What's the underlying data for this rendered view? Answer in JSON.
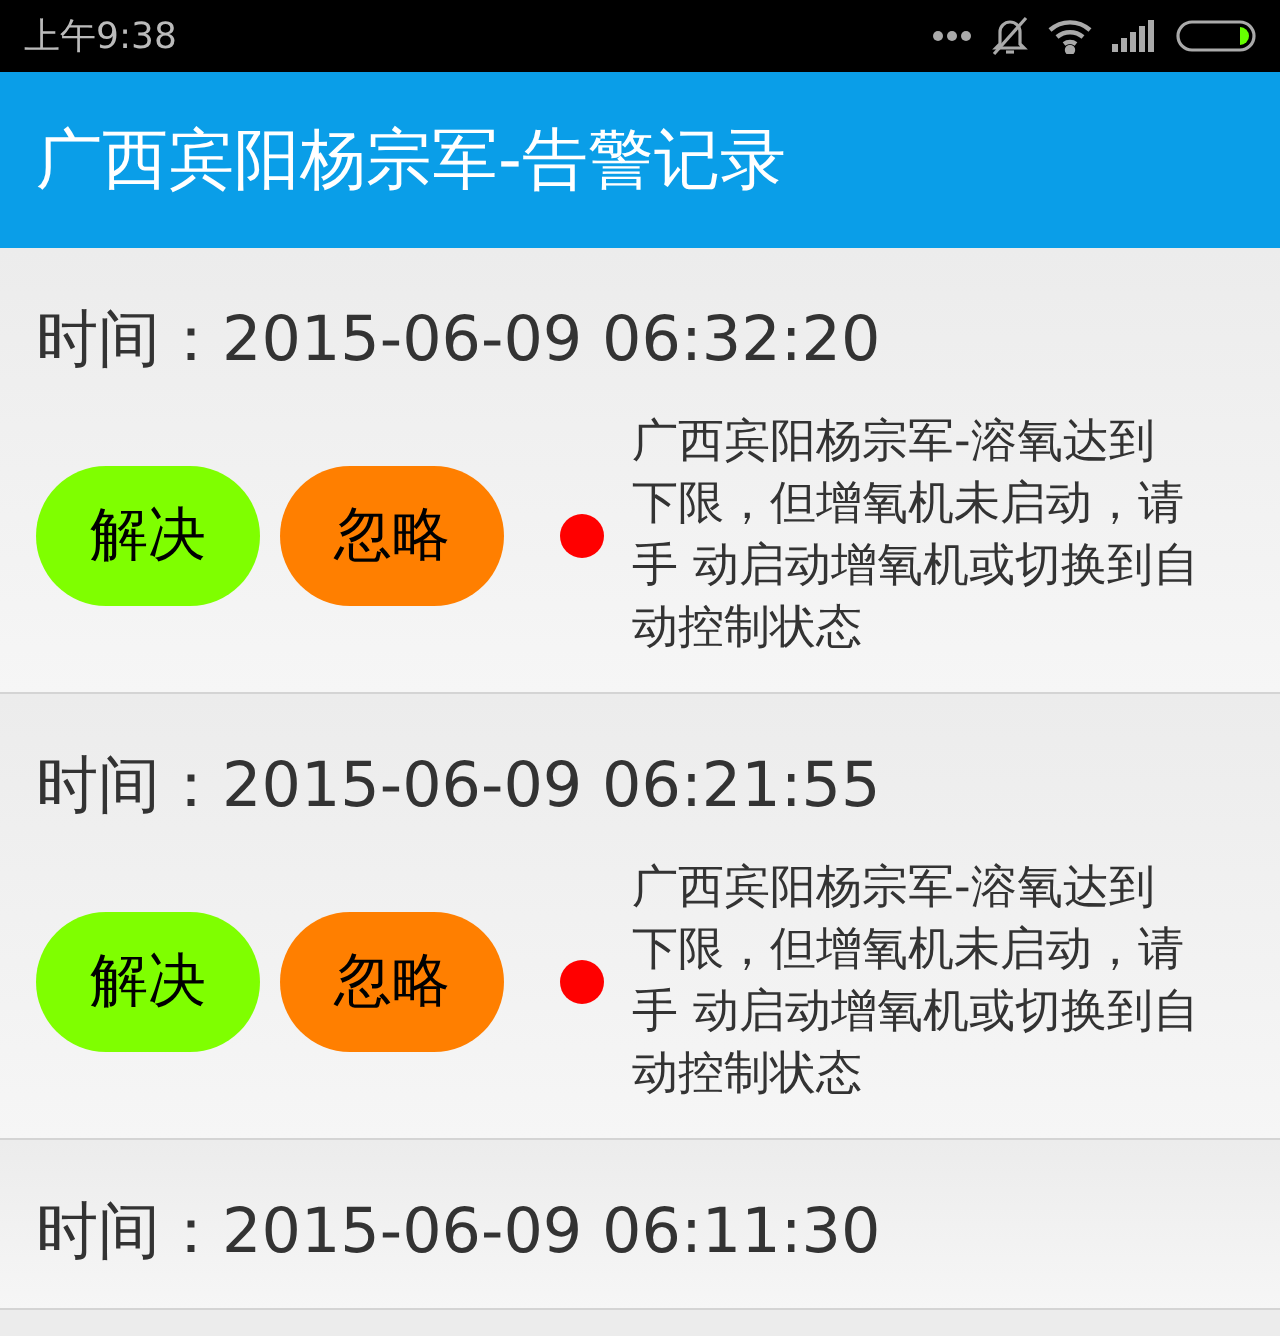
{
  "status_bar": {
    "time": "上午9:38"
  },
  "header": {
    "title": "广西宾阳杨宗军-告警记录"
  },
  "alarms": [
    {
      "time": "时间：2015-06-09 06:32:20",
      "buttons": [
        {
          "label": "解决",
          "kind": "resolve"
        },
        {
          "label": "忽略",
          "kind": "ignore"
        }
      ],
      "color": "#ff0000",
      "message": "广西宾阳杨宗军-溶氧达到下限，但增氧机未启动，请手 动启动增氧机或切换到自动控制状态"
    },
    {
      "time": "时间：2015-06-09 06:21:55",
      "buttons": [
        {
          "label": "解决",
          "kind": "resolve"
        },
        {
          "label": "忽略",
          "kind": "ignore"
        }
      ],
      "color": "#ff0000",
      "message": "广西宾阳杨宗军-溶氧达到下限，但增氧机未启动，请手 动启动增氧机或切换到自动控制状态"
    },
    {
      "time": "时间：2015-06-09 06:11:30"
    }
  ]
}
